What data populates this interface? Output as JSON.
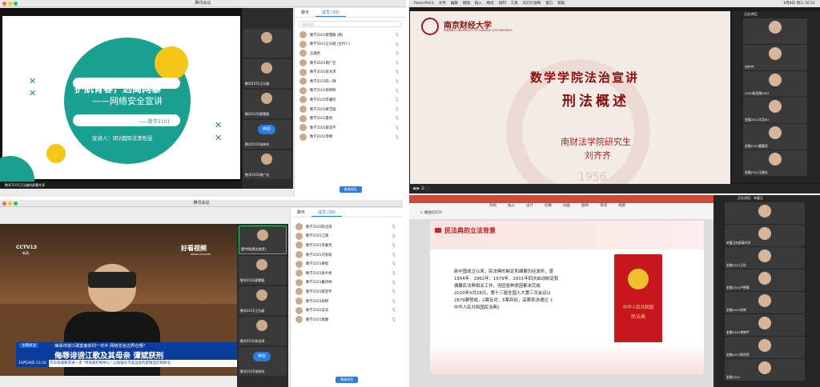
{
  "q1": {
    "window_title": "腾讯会议",
    "slide": {
      "title_line1": "护航青春，远离网暴",
      "title_line2": "——网络安全宣讲",
      "class_line": "——数学2101",
      "speaker": "宣讲人：研2国际法李彤昱"
    },
    "sharer_label": "数学2101王乐越的屏幕共享",
    "thumbs": [
      {
        "name": ""
      },
      {
        "name": "数学2101王乐越"
      },
      {
        "name": "数学2101廖慧颖"
      },
      {
        "name": "数学2101徐佳琪"
      },
      {
        "name": "数学2101张梓彤",
        "tag": "梓彤"
      },
      {
        "name": "数学2101谢广佳"
      }
    ],
    "panel": {
      "tab_chat": "聊天",
      "tab_members": "成员 (39)",
      "search_placeholder": "搜索成员",
      "members": [
        "数学2101廖慧颖 (我)",
        "数学2101王乐越 (主持人)",
        "孟湘君",
        "数学2101谢广佳",
        "数学2101张文琪",
        "数学2101陈一璐",
        "数学2101杨明明",
        "数学2101李嘉彤",
        "数学2101黄艺璇",
        "数学2101夏杨",
        "数学2101蔡思宇",
        "数学2101李桐"
      ],
      "invite_label": "邀请成员"
    }
  },
  "q2": {
    "menu": [
      "PowerPoint",
      "文件",
      "编辑",
      "视图",
      "插入",
      "格式",
      "排列",
      "工具",
      "幻灯片放映",
      "窗口",
      "帮助"
    ],
    "clock": "6月8日 周三 16:51",
    "university_cn": "南京财经大学",
    "university_en": "NANJING UNIVERSITY OF FINANCE & ECONOMICS",
    "title1": "数学学院法治宣讲",
    "title2": "刑法概述",
    "author_line1": "南财法学院研究生",
    "author_line2": "刘齐齐",
    "year": "1956",
    "side_header": "正在讲话：",
    "side_names": [
      "",
      "刘齐齐",
      "2020级金融2001",
      "会展2021文浩SU",
      "金融2101曹嘉玥",
      "金融2101王晓远"
    ]
  },
  "q3": {
    "window_title": "腾讯会议",
    "tv_logo": "CCTV13",
    "tv_sub": "新闻",
    "video_brand": "好看视频",
    "video_url": "www.cctv.com",
    "headline_tag": "主播关注",
    "headline_small": "侮辱诽谤江歌案者获刑一年半 网络发言边界在哪？",
    "headline_big": "侮辱诽谤江歌及其母亲 谭斌获刑",
    "ticker": "京东商城要求进一步 \"传染病控制中心\" 以加强东京奥运会的疫情监控和防治",
    "date_time": "10月28日 23:34",
    "thumbs": [
      {
        "name": "董宇翔(建议使用)"
      },
      {
        "name": "数学2101廖慧颖"
      },
      {
        "name": "数学2101王乐越"
      },
      {
        "name": "数学2101徐佳琪"
      },
      {
        "name": "数学2101张梓彤",
        "tag": "梓彤"
      }
    ],
    "panel": {
      "tab_chat": "聊天",
      "tab_members": "成员 (39)",
      "members": [
        "数学2101陈佳琪",
        "数学2101江璐",
        "数学2101李嘉宣",
        "数学2101刘思雨",
        "数学2101廖程",
        "数学2101张叶帆",
        "数学2101戴玥林",
        "数学2101蔡思宇",
        "数学2101杨柳",
        "数学2101吴双",
        "数学2101唐婕"
      ],
      "invite_label": "邀请成员"
    }
  },
  "q4": {
    "ribbon_tabs": [
      "开始",
      "插入",
      "设计",
      "切换",
      "动画",
      "放映",
      "审阅",
      "视图"
    ],
    "play_label": "播放幻灯片",
    "section_title": "民法典的立法背景",
    "body_lines": [
      "新中国成立以来，民法典的制定和编纂历经波折，曾",
      "1954年、1962年、1979年、2001年四次启动制定和",
      "编纂民法典相关工作，但因各种原因都未完成",
      "2020年5月28日，第十三届全国人大第三次会议以",
      "2879票赞成，2票反对，5票弃权，高票表决通过《",
      "中华人民共和国民法典》"
    ],
    "book_line1": "中华人民共和国",
    "book_line2": "民法典",
    "speaking": "正在讲话：李嘉玉",
    "side_names": [
      "",
      "李嘉玉的屏幕共享",
      "金融2101王佳",
      "金融2101卢德隆",
      "金融2101孙婷",
      "金融2101李晓宇",
      "金融2101陈欣然",
      "金融2101"
    ]
  }
}
